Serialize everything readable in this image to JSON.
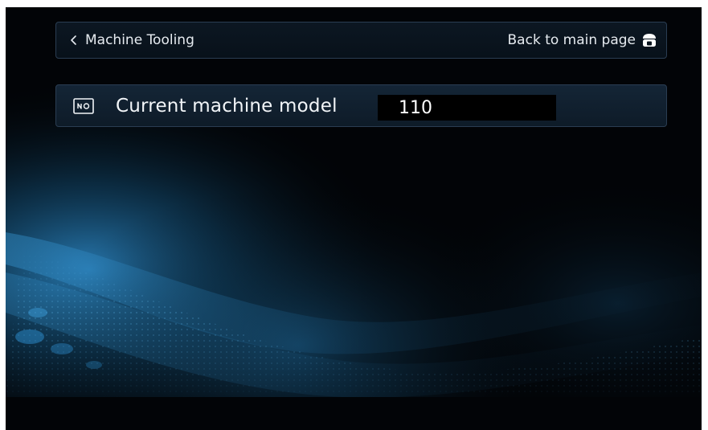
{
  "header": {
    "back_label": "Machine Tooling",
    "main_page_label": "Back to main page"
  },
  "model": {
    "label": "Current machine model",
    "value": "110"
  },
  "colors": {
    "background": "#020407",
    "panel_border": "#2a3d52",
    "accent_blue": "#1f6fa8",
    "text": "#e6ebf0"
  },
  "icons": {
    "back": "chevron-left-icon",
    "home": "home-icon",
    "model": "model-number-icon"
  }
}
